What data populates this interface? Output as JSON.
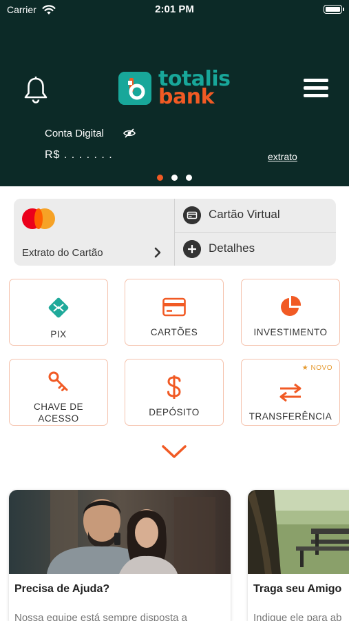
{
  "status_bar": {
    "carrier": "Carrier",
    "time": "2:01 PM"
  },
  "header": {
    "logo_line1": "totalis",
    "logo_line2": "bank",
    "account_label": "Conta Digital",
    "balance_masked": "R$ . . . . . . .",
    "statement_link": "extrato",
    "carousel_pages": 3,
    "carousel_active_index": 0
  },
  "card_panel": {
    "statement_label": "Extrato do Cartão",
    "virtual_card_label": "Cartão Virtual",
    "details_label": "Detalhes"
  },
  "tiles": {
    "pix": "PIX",
    "cards": "CARTÕES",
    "investment": "INVESTIMENTO",
    "access_key": "CHAVE DE ACESSO",
    "deposit": "DEPÓSITO",
    "transfer": "TRANSFERÊNCIA",
    "new_badge": "NOVO"
  },
  "promos": [
    {
      "title": "Precisa de Ajuda?",
      "description": "Nossa equipe está sempre disposta a"
    },
    {
      "title": "Traga seu Amigo",
      "description": "Indique ele para ab"
    }
  ],
  "colors": {
    "header_bg": "#0c2a27",
    "brand_teal": "#18a79a",
    "brand_orange": "#f15a24",
    "tile_border": "#f5c2ac",
    "badge_gold": "#e59a2f"
  },
  "icons": [
    "wifi-icon",
    "battery-icon",
    "bell-icon",
    "hamburger-menu-icon",
    "eye-hidden-icon",
    "mastercard-logo",
    "chevron-right-icon",
    "virtual-card-icon",
    "plus-circle-icon",
    "pix-icon",
    "credit-card-icon",
    "pie-chart-icon",
    "key-icon",
    "dollar-sign-icon",
    "transfer-arrows-icon",
    "star-icon",
    "chevron-down-icon"
  ]
}
